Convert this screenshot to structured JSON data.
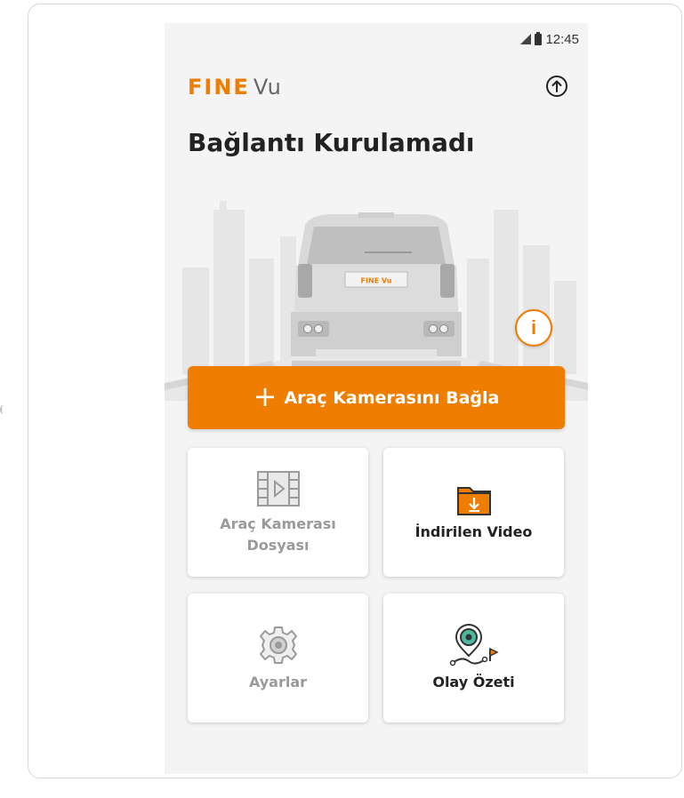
{
  "status_bar": {
    "time": "12:45"
  },
  "header": {
    "logo_primary": "FINE",
    "logo_secondary": "Vu",
    "upload_icon": "upload-circle-icon"
  },
  "main": {
    "title": "Bağlantı Kurulamadı",
    "car_plate": "FINE Vu",
    "info_icon": "info-icon",
    "connect_button": {
      "plus": "+",
      "label": "Araç Kamerasını Bağla"
    }
  },
  "tiles": [
    {
      "label": "Araç Kamerası\nDosyası",
      "icon": "film-icon",
      "state": "disabled"
    },
    {
      "label": "İndirilen Video",
      "icon": "download-folder-icon",
      "state": "active"
    },
    {
      "label": "Ayarlar",
      "icon": "gear-icon",
      "state": "disabled"
    },
    {
      "label": "Olay Özeti",
      "icon": "event-pin-icon",
      "state": "active"
    }
  ],
  "colors": {
    "brand": "#ef7d00",
    "background": "#f4f4f4",
    "disabled_text": "#9a9a9a"
  }
}
